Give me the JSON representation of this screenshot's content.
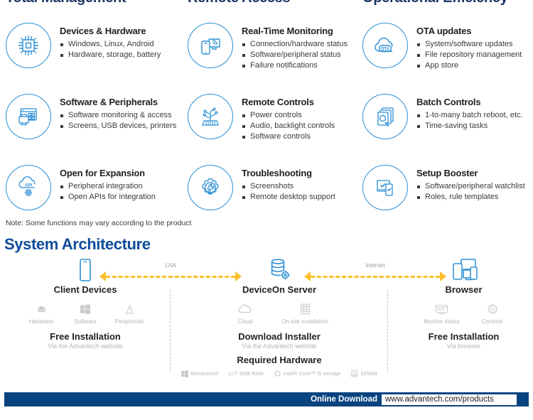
{
  "columns": [
    {
      "header": "Total Management"
    },
    {
      "header": "Remote Access"
    },
    {
      "header": "Operational Efficiency"
    }
  ],
  "features": [
    {
      "icon": "chip-icon",
      "title": "Devices & Hardware",
      "bullets": [
        "Windows, Linux, Android",
        "Hardware, storage, battery"
      ]
    },
    {
      "icon": "realtime-monitor-icon",
      "title": "Real-Time Monitoring",
      "bullets": [
        "Connection/hardware status",
        "Software/peripheral status",
        "Failure notifications"
      ]
    },
    {
      "icon": "ota-cloud-icon",
      "title": "OTA updates",
      "bullets": [
        "System/software updates",
        "File repository management",
        "App store"
      ]
    },
    {
      "icon": "software-peripherals-icon",
      "title": "Software & Peripherals",
      "bullets": [
        "Software monitoring & access",
        "Screens, USB devices, printers"
      ]
    },
    {
      "icon": "remote-controls-icon",
      "title": "Remote Controls",
      "bullets": [
        "Power controls",
        "Audio, backlight controls",
        "Software controls"
      ]
    },
    {
      "icon": "batch-controls-icon",
      "title": "Batch Controls",
      "bullets": [
        "1-to-many batch reboot, etc.",
        "Time-saving tasks"
      ]
    },
    {
      "icon": "api-cloud-icon",
      "title": "Open for Expansion",
      "bullets": [
        "Peripheral integration",
        "Open APIs for integration"
      ]
    },
    {
      "icon": "troubleshooting-gear-icon",
      "title": "Troubleshooting",
      "bullets": [
        "Screenshots",
        "Remote desktop support"
      ]
    },
    {
      "icon": "setup-booster-icon",
      "title": "Setup Booster",
      "bullets": [
        "Software/peripheral watchlist",
        "Roles, rule templates"
      ]
    }
  ],
  "note": "Note: Some functions may vary according to the product",
  "architecture": {
    "title": "System Architecture",
    "links": [
      {
        "name": "LAN"
      },
      {
        "name": "Internet"
      }
    ],
    "client": {
      "icon": "mobile-device-icon",
      "name": "Client Devices",
      "subicons": [
        {
          "icon": "android-icon",
          "label": "Hardware"
        },
        {
          "icon": "windows-icon",
          "label": "Software"
        },
        {
          "icon": "peripheral-icon",
          "label": "Peripherals"
        }
      ],
      "block_title": "Free Installation",
      "block_sub": "Via the Advantech website"
    },
    "server": {
      "icon": "database-server-icon",
      "name": "DeviceOn Server",
      "subicons": [
        {
          "icon": "cloud-icon",
          "label": "Cloud"
        },
        {
          "icon": "onsite-server-icon",
          "label": "On-site installation"
        }
      ],
      "block_title": "Download Installer",
      "block_sub": "Via the Advantech website",
      "hardware_title": "Required Hardware",
      "hardware": [
        {
          "icon": "windows-icon",
          "label": "Windows10"
        },
        {
          "icon": "ram-icon",
          "label": "8GB RAM"
        },
        {
          "icon": "cpu-icon",
          "label": "Intel® Core™ i5 storage"
        },
        {
          "icon": "storage-icon",
          "label": "125GB"
        }
      ]
    },
    "browser": {
      "icon": "multi-device-browser-icon",
      "name": "Browser",
      "subicons": [
        {
          "icon": "monitor-status-icon",
          "label": "Monitor status"
        },
        {
          "icon": "controls-gear-icon",
          "label": "Controls"
        }
      ],
      "block_title": "Free Installation",
      "block_sub": "Via browser"
    }
  },
  "footer": {
    "label": "Online Download",
    "url": "www.advantech.com/products"
  },
  "colors": {
    "heading_navy": "#1b3664",
    "arch_title_blue": "#0f4c9c",
    "icon_blue": "#2b8fd4",
    "arrow_yellow": "#fcbf2e",
    "footer_bar": "#0a4480"
  }
}
